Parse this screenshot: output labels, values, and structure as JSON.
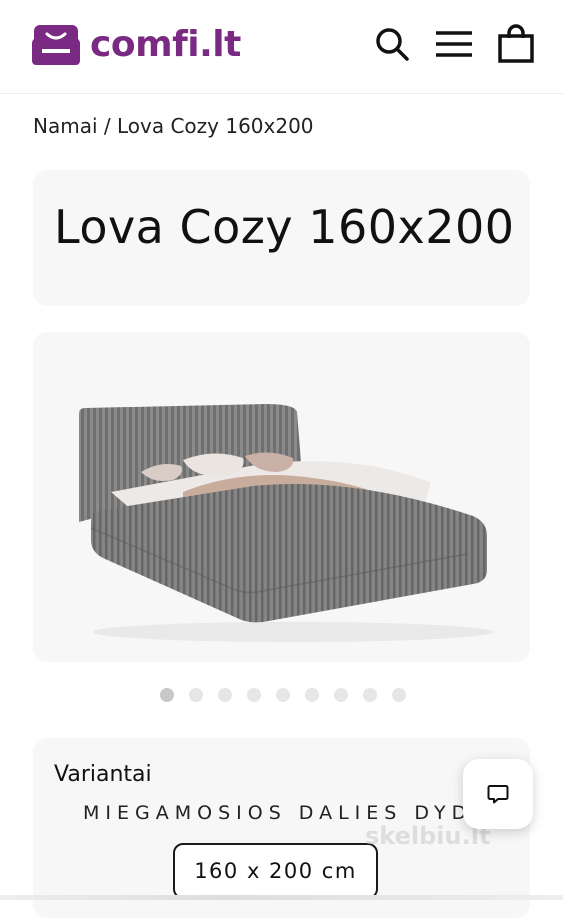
{
  "header": {
    "logo_text": "comfi.lt",
    "brand_color": "#7a2a82",
    "icons": [
      "search-icon",
      "menu-icon",
      "cart-icon"
    ]
  },
  "breadcrumb": {
    "home": "Namai",
    "separator": " / ",
    "current": "Lova Cozy 160x200"
  },
  "product": {
    "title": "Lova Cozy 160x200",
    "gallery": {
      "total_images": 9,
      "active_index": 0
    }
  },
  "variants": {
    "heading": "Variantai",
    "option_label": "MIEGAMOSIOS DALIES DYDIS",
    "selected_value": "160 x 200 cm"
  },
  "chat": {
    "icon": "chat-bubble-icon"
  },
  "watermark": "skelbiu.lt"
}
